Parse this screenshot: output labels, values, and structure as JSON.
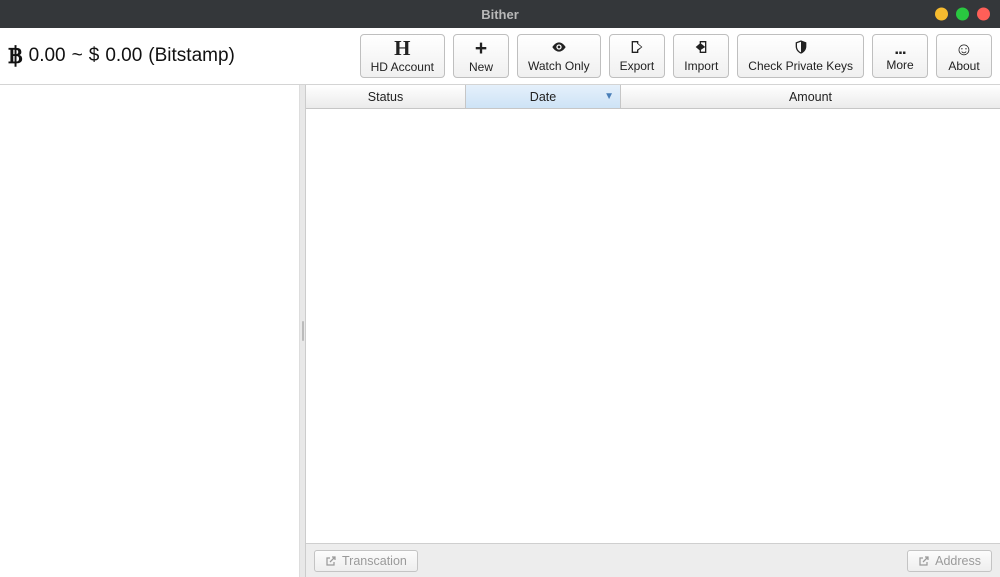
{
  "window": {
    "title": "Bither"
  },
  "balance": {
    "btc": "0.00",
    "separator": "~",
    "fiat_symbol": "$",
    "fiat": "0.00",
    "exchange": "(Bitstamp)"
  },
  "toolbar": {
    "hd_account": {
      "label": "HD Account",
      "icon": "H"
    },
    "new": {
      "label": "New",
      "icon": "+"
    },
    "watch_only": {
      "label": "Watch Only"
    },
    "export": {
      "label": "Export"
    },
    "import": {
      "label": "Import"
    },
    "check_keys": {
      "label": "Check Private Keys"
    },
    "more": {
      "label": "More",
      "icon": "..."
    },
    "about": {
      "label": "About",
      "icon": "☺"
    }
  },
  "table": {
    "columns": {
      "status": "Status",
      "date": "Date",
      "amount": "Amount"
    },
    "sort_arrow": "▼",
    "rows": []
  },
  "footer": {
    "transaction": "Transcation",
    "address": "Address"
  }
}
